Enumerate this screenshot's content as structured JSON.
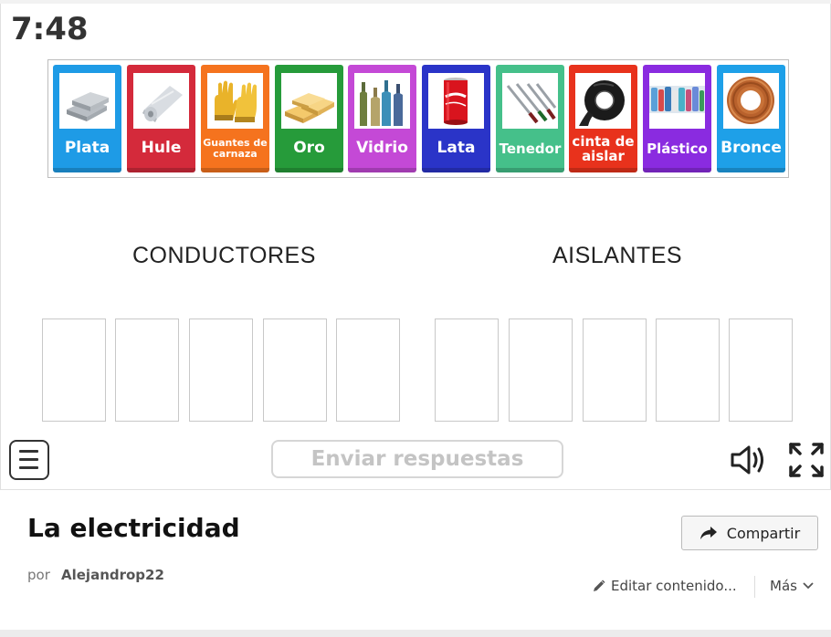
{
  "timer": "7:48",
  "cards": [
    {
      "label": "Plata",
      "color": "#1e9be6",
      "icon": "silver-bars-icon"
    },
    {
      "label": "Hule",
      "color": "#d42a3b",
      "icon": "foil-roll-icon"
    },
    {
      "label": "Guantes de carnaza",
      "color": "#f5731e",
      "icon": "leather-gloves-icon"
    },
    {
      "label": "Oro",
      "color": "#269b3a",
      "icon": "gold-bars-icon"
    },
    {
      "label": "Vidrio",
      "color": "#c449d6",
      "icon": "glass-bottles-icon"
    },
    {
      "label": "Lata",
      "color": "#2a34c8",
      "icon": "soda-can-icon"
    },
    {
      "label": "Tenedor",
      "color": "#45c08a",
      "icon": "forks-icon"
    },
    {
      "label": "cinta de aislar",
      "color": "#e8321c",
      "icon": "electrical-tape-icon"
    },
    {
      "label": "Plástico",
      "color": "#8a2be0",
      "icon": "plastic-bottles-icon"
    },
    {
      "label": "Bronce",
      "color": "#1ea0e8",
      "icon": "copper-wire-icon"
    }
  ],
  "categories": [
    "CONDUCTORES",
    "AISLANTES"
  ],
  "controls": {
    "submit_label": "Enviar respuestas"
  },
  "activity": {
    "title": "La electricidad",
    "by_label": "por",
    "author": "Alejandrop22",
    "share_label": "Compartir",
    "edit_label": "Editar contenido...",
    "more_label": "Más"
  }
}
